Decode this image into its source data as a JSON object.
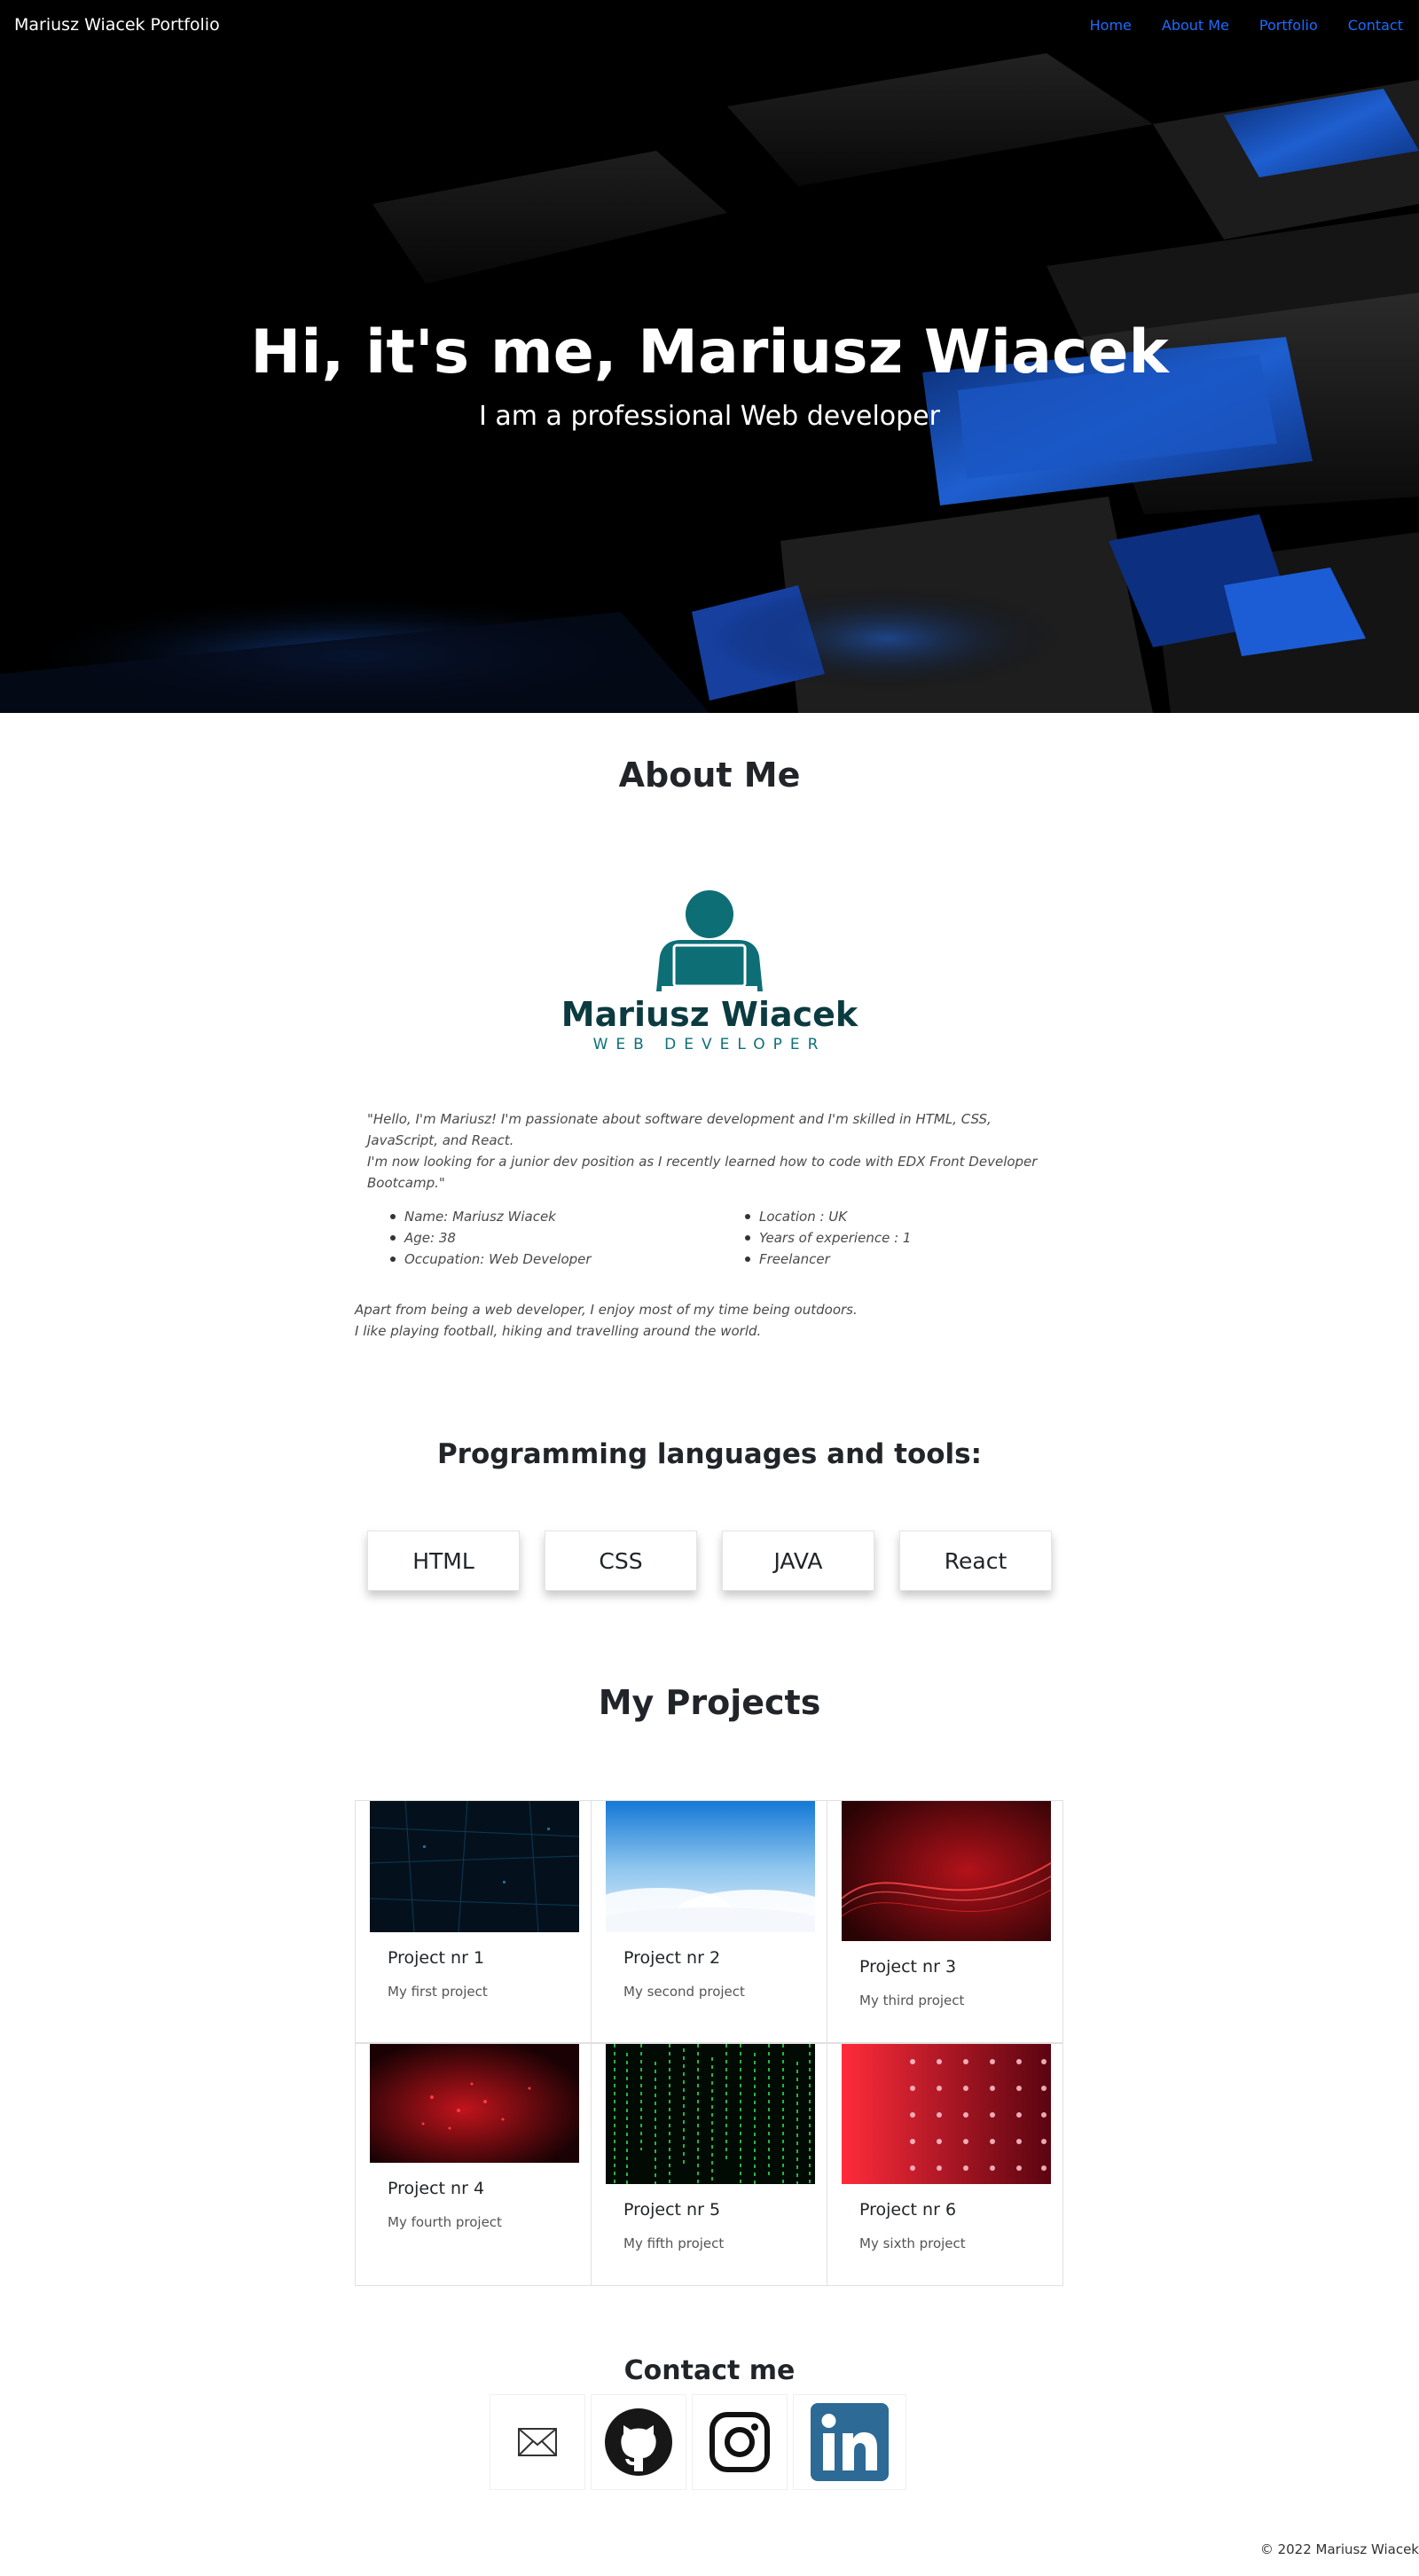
{
  "navbar": {
    "brand": "Mariusz Wiacek Portfolio",
    "links": [
      "Home",
      "About Me",
      "Portfolio",
      "Contact"
    ]
  },
  "hero": {
    "title": "Hi, it's me, Mariusz Wiacek",
    "subtitle": "I am a professional Web developer"
  },
  "about": {
    "title": "About Me",
    "logo_name": "Mariusz Wiacek",
    "logo_subtitle": "WEB DEVELOPER",
    "intro_line1": "\"Hello, I'm Mariusz! I'm passionate about software development and I'm skilled in HTML, CSS, JavaScript, and React.",
    "intro_line2": "I'm now looking for a junior dev position as I recently learned how to code with EDX Front Developer Bootcamp.\"",
    "list_left": [
      "Name: Mariusz Wiacek",
      "Age: 38",
      "Occupation: Web Developer"
    ],
    "list_right": [
      "Location : UK",
      "Years of experience : 1",
      "Freelancer"
    ],
    "extra_line1": "Apart from being a web developer, I enjoy most of my time being outdoors.",
    "extra_line2": "I like playing football, hiking and travelling around the world."
  },
  "skills": {
    "title": "Programming languages and tools:",
    "items": [
      "HTML",
      "CSS",
      "JAVA",
      "React"
    ]
  },
  "projects": {
    "title": "My Projects",
    "items": [
      {
        "title": "Project nr 1",
        "text": "My first project"
      },
      {
        "title": "Project nr 2",
        "text": "My second project"
      },
      {
        "title": "Project nr 3",
        "text": "My third project"
      },
      {
        "title": "Project nr 4",
        "text": "My fourth project"
      },
      {
        "title": "Project nr 5",
        "text": "My fifth project"
      },
      {
        "title": "Project nr 6",
        "text": "My sixth project"
      }
    ]
  },
  "contact": {
    "title": "Contact me",
    "icons": [
      "email-icon",
      "github-icon",
      "instagram-icon",
      "linkedin-icon"
    ]
  },
  "footer": {
    "text": "© 2022 Mariusz Wiacek"
  },
  "colors": {
    "nav_link": "#1a6dff",
    "logo_teal": "#0d6e76",
    "linkedin": "#2d6a96"
  }
}
